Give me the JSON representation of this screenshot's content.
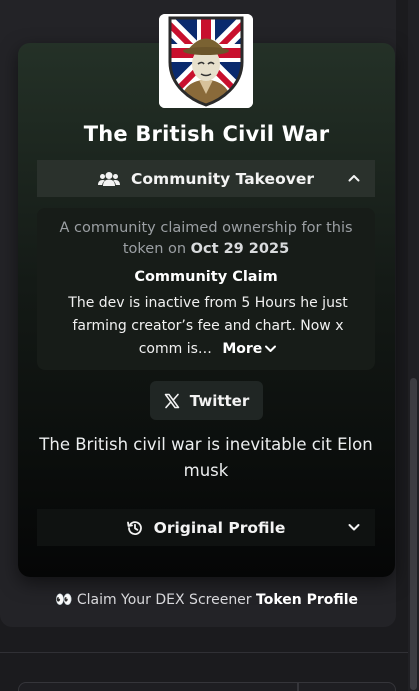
{
  "token": {
    "name": "The British Civil War",
    "logo_icon": "union-jack-soldier-logo"
  },
  "community_takeover": {
    "label": "Community Takeover",
    "icon": "users-icon",
    "expanded": true,
    "desc_prefix": "A community claimed ownership for this token on",
    "date": "Oct 29 2025",
    "claim_heading": "Community Claim",
    "claim_text": "The dev is inactive from 5 Hours he just farming creator’s fee and chart. Now x comm is…",
    "more_label": "More"
  },
  "socials": {
    "twitter_label": "Twitter",
    "twitter_icon": "x-logo-icon"
  },
  "description": "The British civil war is inevitable cit Elon musk",
  "original_profile": {
    "label": "Original Profile",
    "icon": "history-icon"
  },
  "claim_profile": {
    "emoji": "👀",
    "prefix": "Claim Your DEX Screener",
    "bold": "Token Profile"
  },
  "colors": {
    "background": "#1b1b1e",
    "card_top": "#243127",
    "card_bottom": "#050606",
    "accent_text": "#ffffff"
  }
}
